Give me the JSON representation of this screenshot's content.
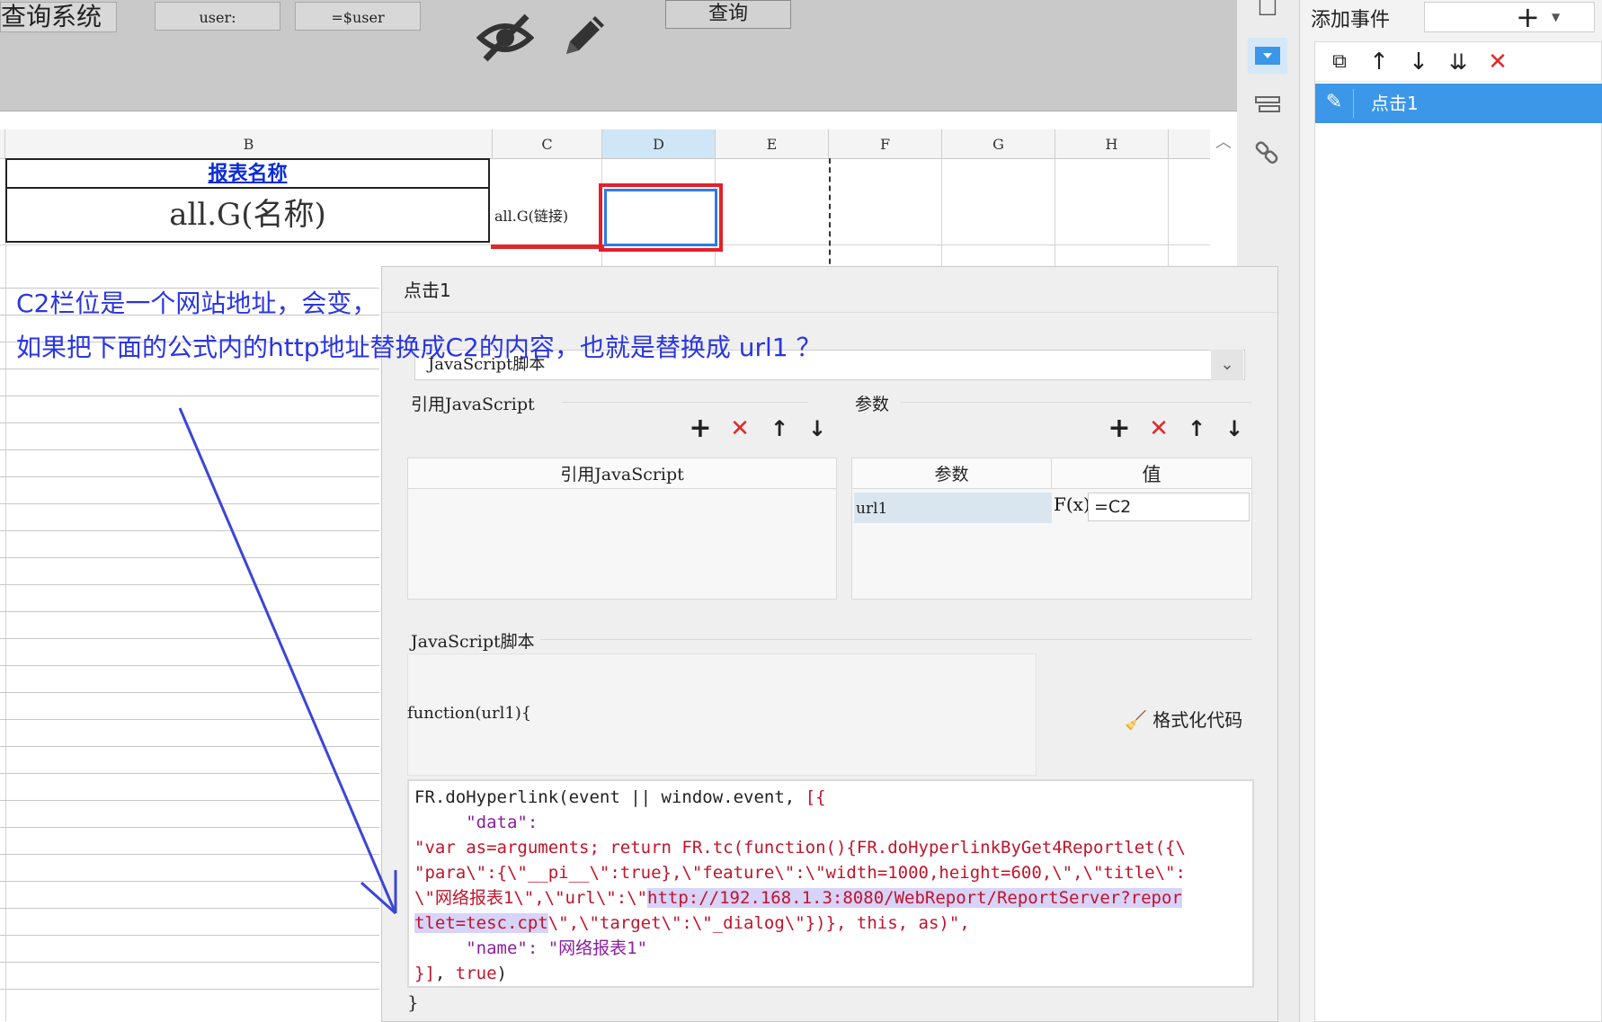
{
  "param_area": {
    "title": "查询系统",
    "user_label": "user:",
    "user_value": "=$user",
    "query_button": "查询"
  },
  "sheet": {
    "columns": [
      "B",
      "C",
      "D",
      "E",
      "F",
      "G",
      "H"
    ],
    "selected_column": "D",
    "cell_b1": "报表名称",
    "cell_b2": "all.G(名称)",
    "cell_c2": "all.G(链接)"
  },
  "annotation": {
    "line1": "C2栏位是一个网站地址，会变，",
    "line2": "如果把下面的公式内的http地址替换成C2的内容，也就是替换成 url1 ？"
  },
  "event_panel": {
    "title": "添加事件",
    "add_icon": "+",
    "items": [
      {
        "label": "点击1",
        "icon": "pencil-icon"
      }
    ]
  },
  "dialog": {
    "title": "点击1",
    "type_select": "JavaScript脚本",
    "js_ref_label": "引用JavaScript",
    "js_ref_header": "引用JavaScript",
    "params_label": "参数",
    "param_header_name": "参数",
    "param_header_value": "值",
    "param_row": {
      "name": "url1",
      "fx": "F(x)",
      "value": "=C2"
    },
    "js_label": "JavaScript脚本",
    "function_signature": "function(url1){",
    "format_button": "格式化代码",
    "code_end": "}",
    "code_lines": [
      "FR.doHyperlink(event || window.event, [{",
      "     \"data\":",
      "\"var as=arguments; return FR.tc(function(){FR.doHyperlinkByGet4Reportlet({\\",
      "\"para\\\":{\\\"__pi__\\\":true},\\\"feature\\\":\\\"width=1000,height=600,\\\",\\\"title\\\":",
      "\\\"网络报表1\\\",\\\"url\\\":\\\"http://192.168.1.3:8080/WebReport/ReportServer?repor",
      "tlet=tesc.cpt\\\",\\\"target\\\":\\\"_dialog\\\"})}, this, as)\",",
      "     \"name\": \"网络报表1\"",
      "}], true)"
    ]
  },
  "colors": {
    "accent_blue": "#3c97e8",
    "annotation_blue": "#2a36e0",
    "highlight_red": "#e0262a",
    "code_string": "#c0142a",
    "code_highlight": "#d7d3f9"
  }
}
